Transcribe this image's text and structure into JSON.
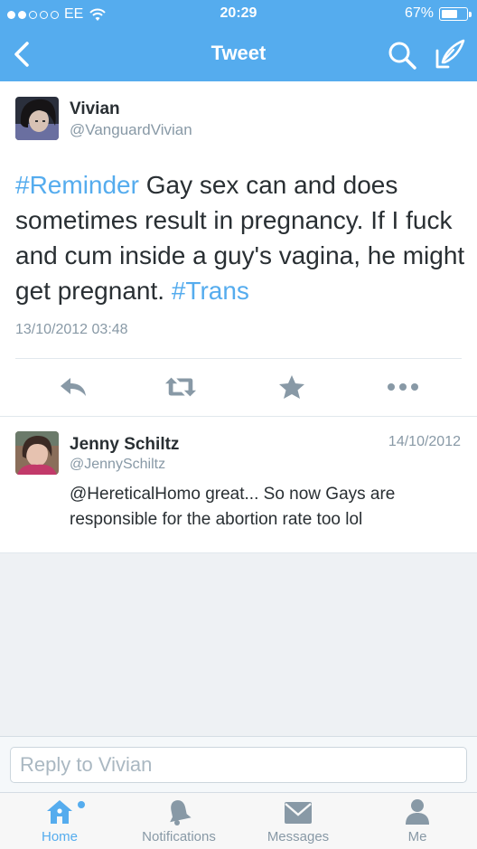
{
  "status_bar": {
    "carrier": "EE",
    "time": "20:29",
    "battery": "67%",
    "battery_level": 0.67
  },
  "nav": {
    "title": "Tweet"
  },
  "tweet": {
    "name": "Vivian",
    "handle": "@VanguardVivian",
    "hashtag_1": "#Reminder",
    "body": " Gay sex can and does sometimes result in pregnancy. If I fuck and cum inside a guy's vagina, he might get pregnant. ",
    "hashtag_2": "#Trans",
    "timestamp": "13/10/2012 03:48",
    "actions": [
      "reply-icon",
      "retweet-icon",
      "favorite-icon",
      "more-icon"
    ]
  },
  "reply": {
    "name": "Jenny Schiltz",
    "handle": "@JennySchiltz",
    "date": "14/10/2012",
    "text": "@HereticalHomo great... So now Gays are responsible for the abortion rate too lol"
  },
  "reply_box": {
    "placeholder": "Reply to Vivian"
  },
  "tabs": [
    {
      "label": "Home",
      "icon": "home-icon",
      "active": true
    },
    {
      "label": "Notifications",
      "icon": "bell-icon",
      "active": false
    },
    {
      "label": "Messages",
      "icon": "envelope-icon",
      "active": false
    },
    {
      "label": "Me",
      "icon": "person-icon",
      "active": false
    }
  ],
  "colors": {
    "accent": "#55acee",
    "text": "#292f33",
    "muted": "#8899a6",
    "action_icon": "#8899a6"
  }
}
